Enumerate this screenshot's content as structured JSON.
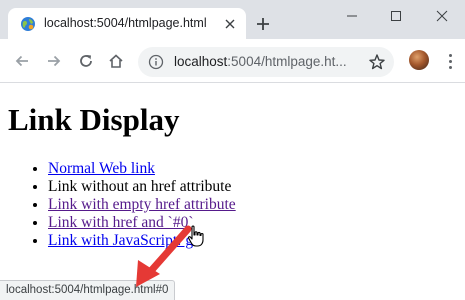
{
  "browser": {
    "tab": {
      "title": "localhost:5004/htmlpage.html"
    },
    "omnibox": {
      "host": "localhost",
      "rest": ":5004/htmlpage.ht..."
    },
    "accent_color": "#dee1e6"
  },
  "page": {
    "title": "Link Display",
    "items": [
      {
        "text": "Normal Web link",
        "is_link": true,
        "visited": false
      },
      {
        "text": "Link without an href attribute",
        "is_link": false,
        "visited": false
      },
      {
        "text": "Link with empty href attribute",
        "is_link": true,
        "visited": true
      },
      {
        "text": "Link with href and `#0`",
        "is_link": true,
        "visited": true
      },
      {
        "text": "Link with JavaScript: g",
        "is_link": true,
        "visited": false
      }
    ]
  },
  "status_bar": {
    "text": "localhost:5004/htmlpage.html#0"
  },
  "annotation": {
    "arrow_color": "#e53935"
  }
}
